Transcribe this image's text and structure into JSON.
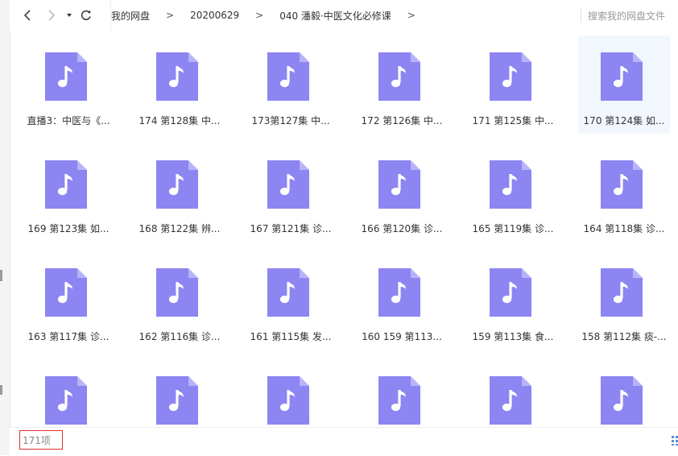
{
  "toolbar": {
    "back_icon": "chevron-left",
    "forward_icon": "chevron-right",
    "dropdown_icon": "caret-down",
    "refresh_icon": "refresh"
  },
  "breadcrumb": {
    "items": [
      "我的网盘",
      "20200629",
      "040 潘毅·中医文化必修课"
    ],
    "separator": ">"
  },
  "search": {
    "placeholder": "搜索我的网盘文件"
  },
  "files": [
    {
      "name": "直播3：中医与《...",
      "type": "audio-file-icon"
    },
    {
      "name": "174 第128集 中...",
      "type": "audio-file-icon"
    },
    {
      "name": "173第127集 中...",
      "type": "audio-file-icon"
    },
    {
      "name": "172 第126集 中...",
      "type": "audio-file-icon"
    },
    {
      "name": "171 第125集 中...",
      "type": "audio-file-icon"
    },
    {
      "name": "170 第124集 如...",
      "type": "audio-file-icon",
      "selected": true
    },
    {
      "name": "169 第123集 如...",
      "type": "audio-file-icon"
    },
    {
      "name": "168 第122集 辨...",
      "type": "audio-file-icon"
    },
    {
      "name": "167 第121集 诊...",
      "type": "audio-file-icon"
    },
    {
      "name": "166 第120集 诊...",
      "type": "audio-file-icon"
    },
    {
      "name": "165 第119集 诊...",
      "type": "audio-file-icon"
    },
    {
      "name": "164 第118集 诊...",
      "type": "audio-file-icon"
    },
    {
      "name": "163 第117集 诊...",
      "type": "audio-file-icon"
    },
    {
      "name": "162 第116集 诊...",
      "type": "audio-file-icon"
    },
    {
      "name": "161 第115集 发...",
      "type": "audio-file-icon"
    },
    {
      "name": "160 159 第113...",
      "type": "audio-file-icon"
    },
    {
      "name": "159 第113集 食...",
      "type": "audio-file-icon"
    },
    {
      "name": "158 第112集 痰-...",
      "type": "audio-file-icon"
    },
    {
      "name": "",
      "type": "audio-file-icon"
    },
    {
      "name": "",
      "type": "audio-file-icon"
    },
    {
      "name": "",
      "type": "audio-file-icon"
    },
    {
      "name": "",
      "type": "audio-file-icon"
    },
    {
      "name": "",
      "type": "audio-file-icon"
    },
    {
      "name": "",
      "type": "audio-file-icon"
    }
  ],
  "status": {
    "count_label": "171项"
  },
  "colors": {
    "icon_fill": "#8c85f2",
    "icon_fold": "#b8b3f8",
    "highlight_border": "#e0302f",
    "selected_bg": "#f2f7fd"
  }
}
